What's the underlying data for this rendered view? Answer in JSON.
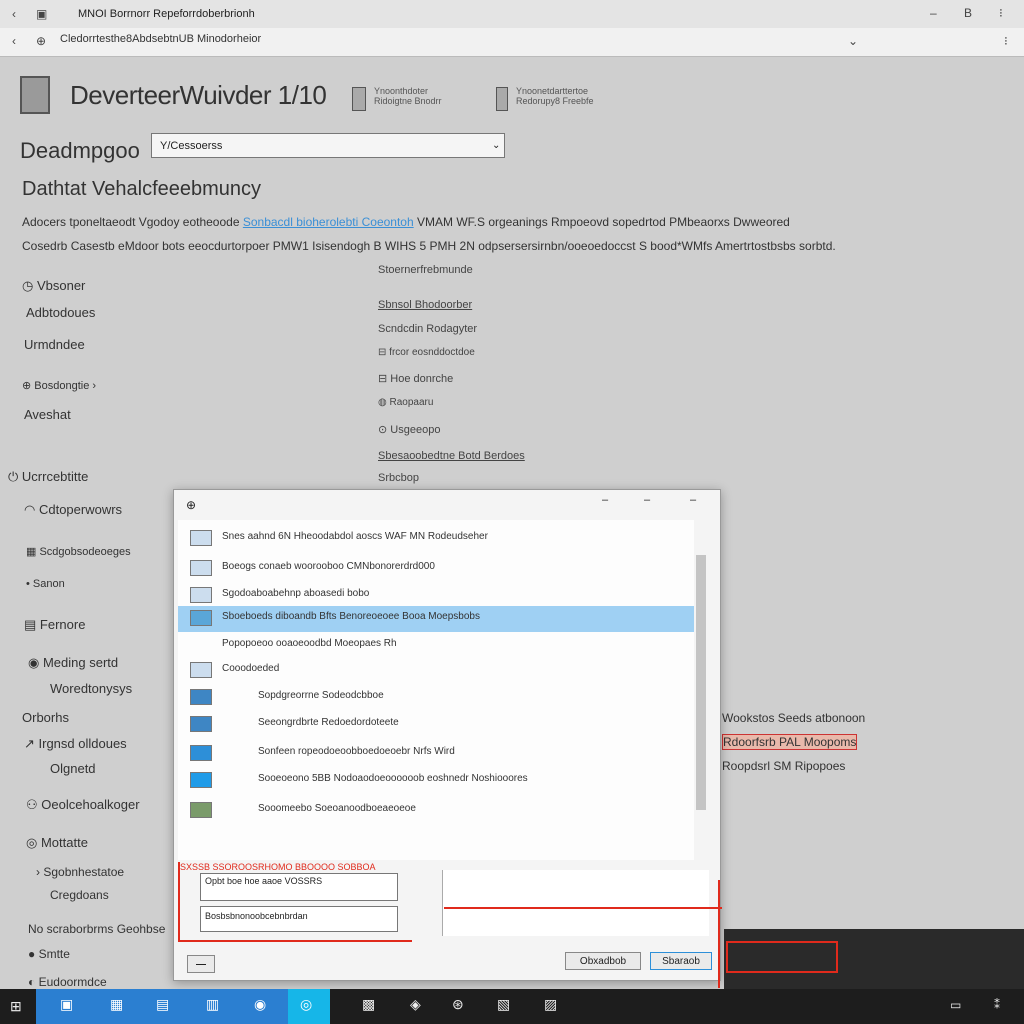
{
  "window": {
    "title": "MNOI Borrnorr Repeforrdoberbrionh",
    "address": "Cledorrtesthe8AbdsebtnUB Minodorheior",
    "nav_back": "‹",
    "nav_fwd": "⊕",
    "btn_min": "–",
    "btn_max": "B",
    "btn_close": "⁝"
  },
  "header": {
    "title": "DeverteerWuivder 1/10",
    "info1": "Ynoonthdoter\nRidoigtne Bnodrr",
    "info2": "Ynoonetdarttertoe\nRedorupy8 Freebfe"
  },
  "main": {
    "label": "Deadmpgoo",
    "select_value": "Y/Cessoerss",
    "subheading": "Dathtat Vehalcfeeebmuncy",
    "desc1": "Adocers tponeltaeodt  Vgodoy eotheoode",
    "desc1_link": "Sonbacdl bioherolebti Coeontoh",
    "desc1_tail": "VMAM  WF.S orgeanings  Rmpoeovd sopedrtod PMbeaorxs  Dwweored",
    "desc2": "Cosedrb Casestb eMdoor bots eeocdurtorpoer PMW1  Isisendogh B  WIHS 5 PMH 2N  odpsersersirnbn/ooeoedoccst  S bood*WMfs  Amertrtostbsbs sorbtd."
  },
  "sidebar": {
    "items": [
      {
        "label": "Vbsoner",
        "icon": "clock-icon"
      },
      {
        "label": "Adbtodoues",
        "icon": ""
      },
      {
        "label": "Urmdndee",
        "icon": ""
      },
      {
        "label": "Bosdongtie",
        "icon": "globe-icon"
      },
      {
        "label": "Aveshat",
        "icon": ""
      },
      {
        "label": "Ucrrcebtitte",
        "icon": "power-icon"
      },
      {
        "label": "Cdtoperwowrs",
        "icon": "wifi-icon"
      },
      {
        "label": "Scdgobsodeoeges",
        "icon": "grid-icon"
      },
      {
        "label": "Sanon",
        "icon": ""
      },
      {
        "label": "Fernore",
        "icon": "doc-icon"
      },
      {
        "label": "Meding sertd",
        "icon": "eye-icon"
      },
      {
        "label": "Woredtonysys",
        "icon": ""
      },
      {
        "label": "Orborhs",
        "icon": ""
      },
      {
        "label": "Irgnsd olldoues",
        "icon": "arrow-icon"
      },
      {
        "label": "Olgnetd",
        "icon": ""
      },
      {
        "label": "Oeolcehoalkoger",
        "icon": "people-icon"
      },
      {
        "label": "Mottatte",
        "icon": "chat-icon"
      },
      {
        "label": "Sgobnhestatoe",
        "icon": ""
      },
      {
        "label": "Cregdoans",
        "icon": ""
      },
      {
        "label": "No scraborbrms Geohbse",
        "icon": ""
      },
      {
        "label": "Smtte",
        "icon": ""
      },
      {
        "label": "Eudoormdce",
        "icon": ""
      }
    ]
  },
  "center": {
    "items": [
      {
        "label": "Stoernerfrebmunde",
        "type": "text"
      },
      {
        "label": "Sbnsol Bhodoorber",
        "type": "link"
      },
      {
        "label": "Scndcdin Rodagyter",
        "type": "text"
      },
      {
        "label": "frcor eosnddoctdoe",
        "type": "text"
      },
      {
        "label": "Hoe donrche",
        "type": "text"
      },
      {
        "label": "Raopaaru",
        "type": "text"
      },
      {
        "label": "Usgeeopo",
        "type": "text"
      },
      {
        "label": "Sbesaoobedtne Botd Berdoes",
        "type": "link"
      },
      {
        "label": "Srbcbop",
        "type": "text"
      }
    ]
  },
  "right": {
    "line1": "Wookstos  Seeds atbonoon",
    "line2": "Rdoorfsrb PAL Moopoms",
    "line3": "Roopdsrl SM Ripopoes"
  },
  "dialog": {
    "icon": "⊕",
    "rows": [
      {
        "text": "Snes aahnd 6N Hheoodabdol aoscs WAF MN Rodeudseher",
        "selected": false
      },
      {
        "text": "Boeogs conaeb woorooboo CMNbonorerdrd000",
        "selected": false
      },
      {
        "text": "Sgodoaboabehnp aboasedi bobo",
        "selected": false
      },
      {
        "text": "Sboeboeds diboandb Bfts Benoreoeoee Booa Moepsbobs",
        "selected": true
      },
      {
        "text": "Popopoeoo ooaoeoodbd Moeopaes Rh",
        "selected": false
      },
      {
        "text": "Cooodoeded",
        "selected": false
      },
      {
        "text": "Sopdgreorrne Sodeodcbboe",
        "selected": false
      },
      {
        "text": "Seeongrdbrte Redoedordoteete",
        "selected": false
      },
      {
        "text": "Sonfeen ropeodoeoobboedoeoebr Nrfs Wird",
        "selected": false
      },
      {
        "text": "Sooeoeono 5BB Nodoaodoeoooooob eoshnedr Noshiooores",
        "selected": false
      },
      {
        "text": "Sooomeebo Soeoanoodboeaeoeoe",
        "selected": false
      }
    ],
    "bottom_header": "SXSSB SSOROOSRHOMO BBOOOO SOBBOA",
    "bottom_line1": "Opbt boe hoe aaoe VOSSRS",
    "bottom_line2": "Bosbsbnonoobcebnbrdan",
    "btn_left": "⎯⎯",
    "btn_mid": "Obxadbob",
    "btn_right": "Sbaraob"
  },
  "taskbar": {
    "items": [
      "Start",
      "Files",
      "Edge",
      "Store",
      "Mail",
      "Settings"
    ]
  },
  "colors": {
    "accent": "#3a8fd6",
    "selection": "#9fd0f3",
    "annotation": "#e02a1c"
  }
}
